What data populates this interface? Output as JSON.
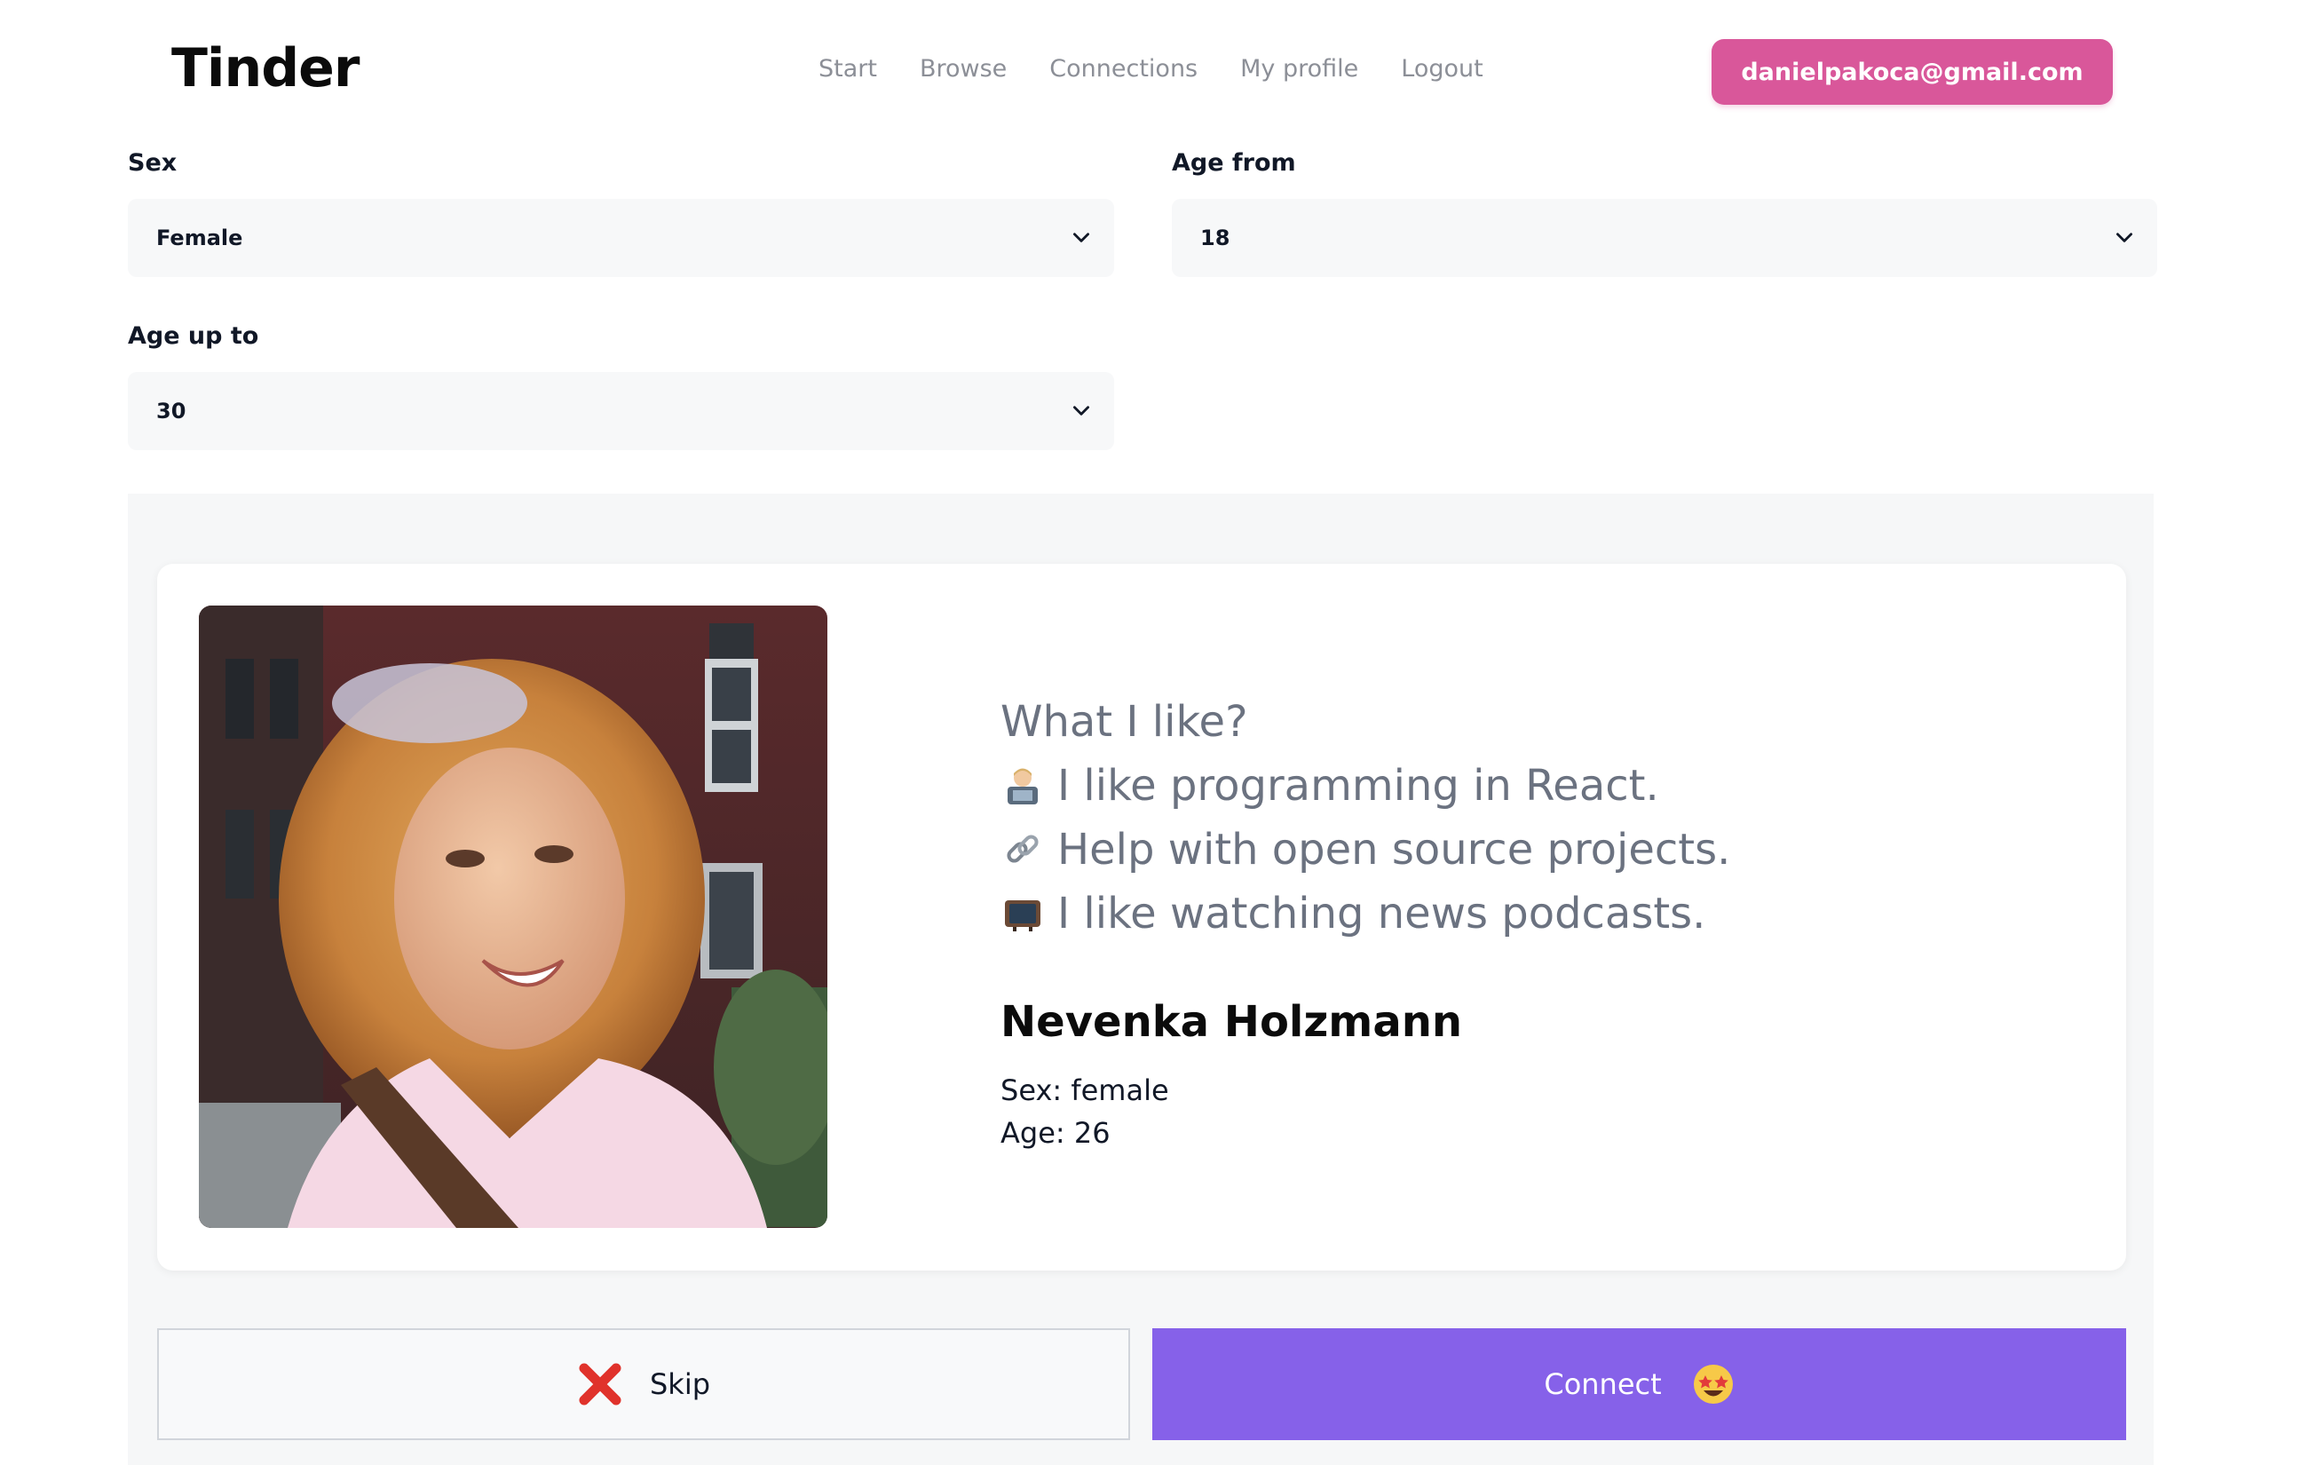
{
  "header": {
    "logo": "Tinder",
    "nav": [
      "Start",
      "Browse",
      "Connections",
      "My profile",
      "Logout"
    ],
    "account_email": "danielpakoca@gmail.com"
  },
  "filters": {
    "sex": {
      "label": "Sex",
      "value": "Female"
    },
    "age_from": {
      "label": "Age from",
      "value": "18"
    },
    "age_up_to": {
      "label": "Age up to",
      "value": "30"
    }
  },
  "profile": {
    "likes_title": "What I like?",
    "likes": [
      {
        "icon": "technologist-icon",
        "text": "I like programming in React."
      },
      {
        "icon": "link-icon",
        "text": "Help with open source projects."
      },
      {
        "icon": "television-icon",
        "text": "I like watching news podcasts."
      }
    ],
    "name": "Nevenka Holzmann",
    "sex_line": "Sex: female",
    "age_line": "Age: 26"
  },
  "actions": {
    "skip_label": "Skip",
    "connect_label": "Connect"
  },
  "colors": {
    "accent_pink": "#d9579a",
    "connect_purple": "#8661e9",
    "skip_red": "#e0322b",
    "nav_gray": "#8c8f97"
  }
}
